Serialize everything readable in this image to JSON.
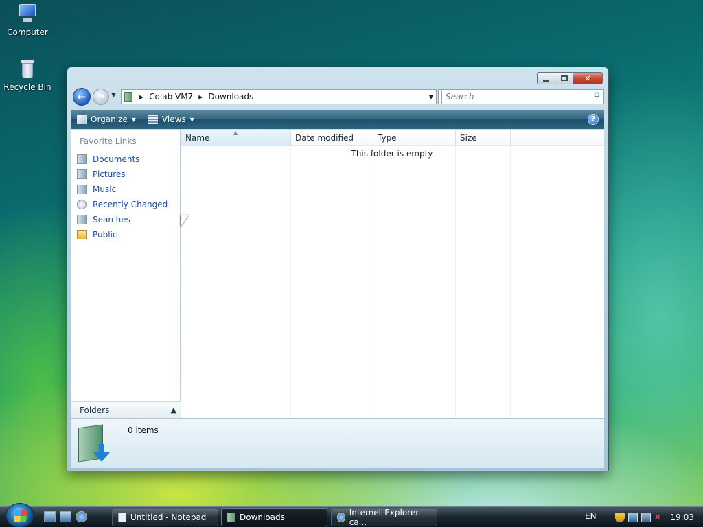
{
  "desktop": {
    "icons": [
      {
        "label": "Computer",
        "icon": "computer-icon"
      },
      {
        "label": "Recycle Bin",
        "icon": "recycle-bin-icon"
      }
    ]
  },
  "window": {
    "address": {
      "crumbs": [
        "Colab VM7",
        "Downloads"
      ]
    },
    "search": {
      "placeholder": "Search"
    },
    "toolbar": {
      "organize": "Organize",
      "views": "Views",
      "help": "?"
    },
    "nav_pane": {
      "heading": "Favorite Links",
      "items": [
        {
          "label": "Documents",
          "icon": "documents-icon"
        },
        {
          "label": "Pictures",
          "icon": "pictures-icon"
        },
        {
          "label": "Music",
          "icon": "music-icon"
        },
        {
          "label": "Recently Changed",
          "icon": "recently-changed-icon"
        },
        {
          "label": "Searches",
          "icon": "searches-icon"
        },
        {
          "label": "Public",
          "icon": "public-folder-icon"
        }
      ],
      "folders_label": "Folders"
    },
    "columns": [
      "Name",
      "Date modified",
      "Type",
      "Size"
    ],
    "empty_message": "This folder is empty.",
    "details": {
      "item_count": "0 items"
    }
  },
  "taskbar": {
    "buttons": [
      {
        "label": "Untitled - Notepad",
        "icon": "notepad-icon",
        "active": false
      },
      {
        "label": "Downloads",
        "icon": "folder-icon",
        "active": true
      },
      {
        "label": "Internet Explorer ca...",
        "icon": "internet-explorer-icon",
        "active": false
      }
    ],
    "language": "EN",
    "clock": "19:03"
  }
}
